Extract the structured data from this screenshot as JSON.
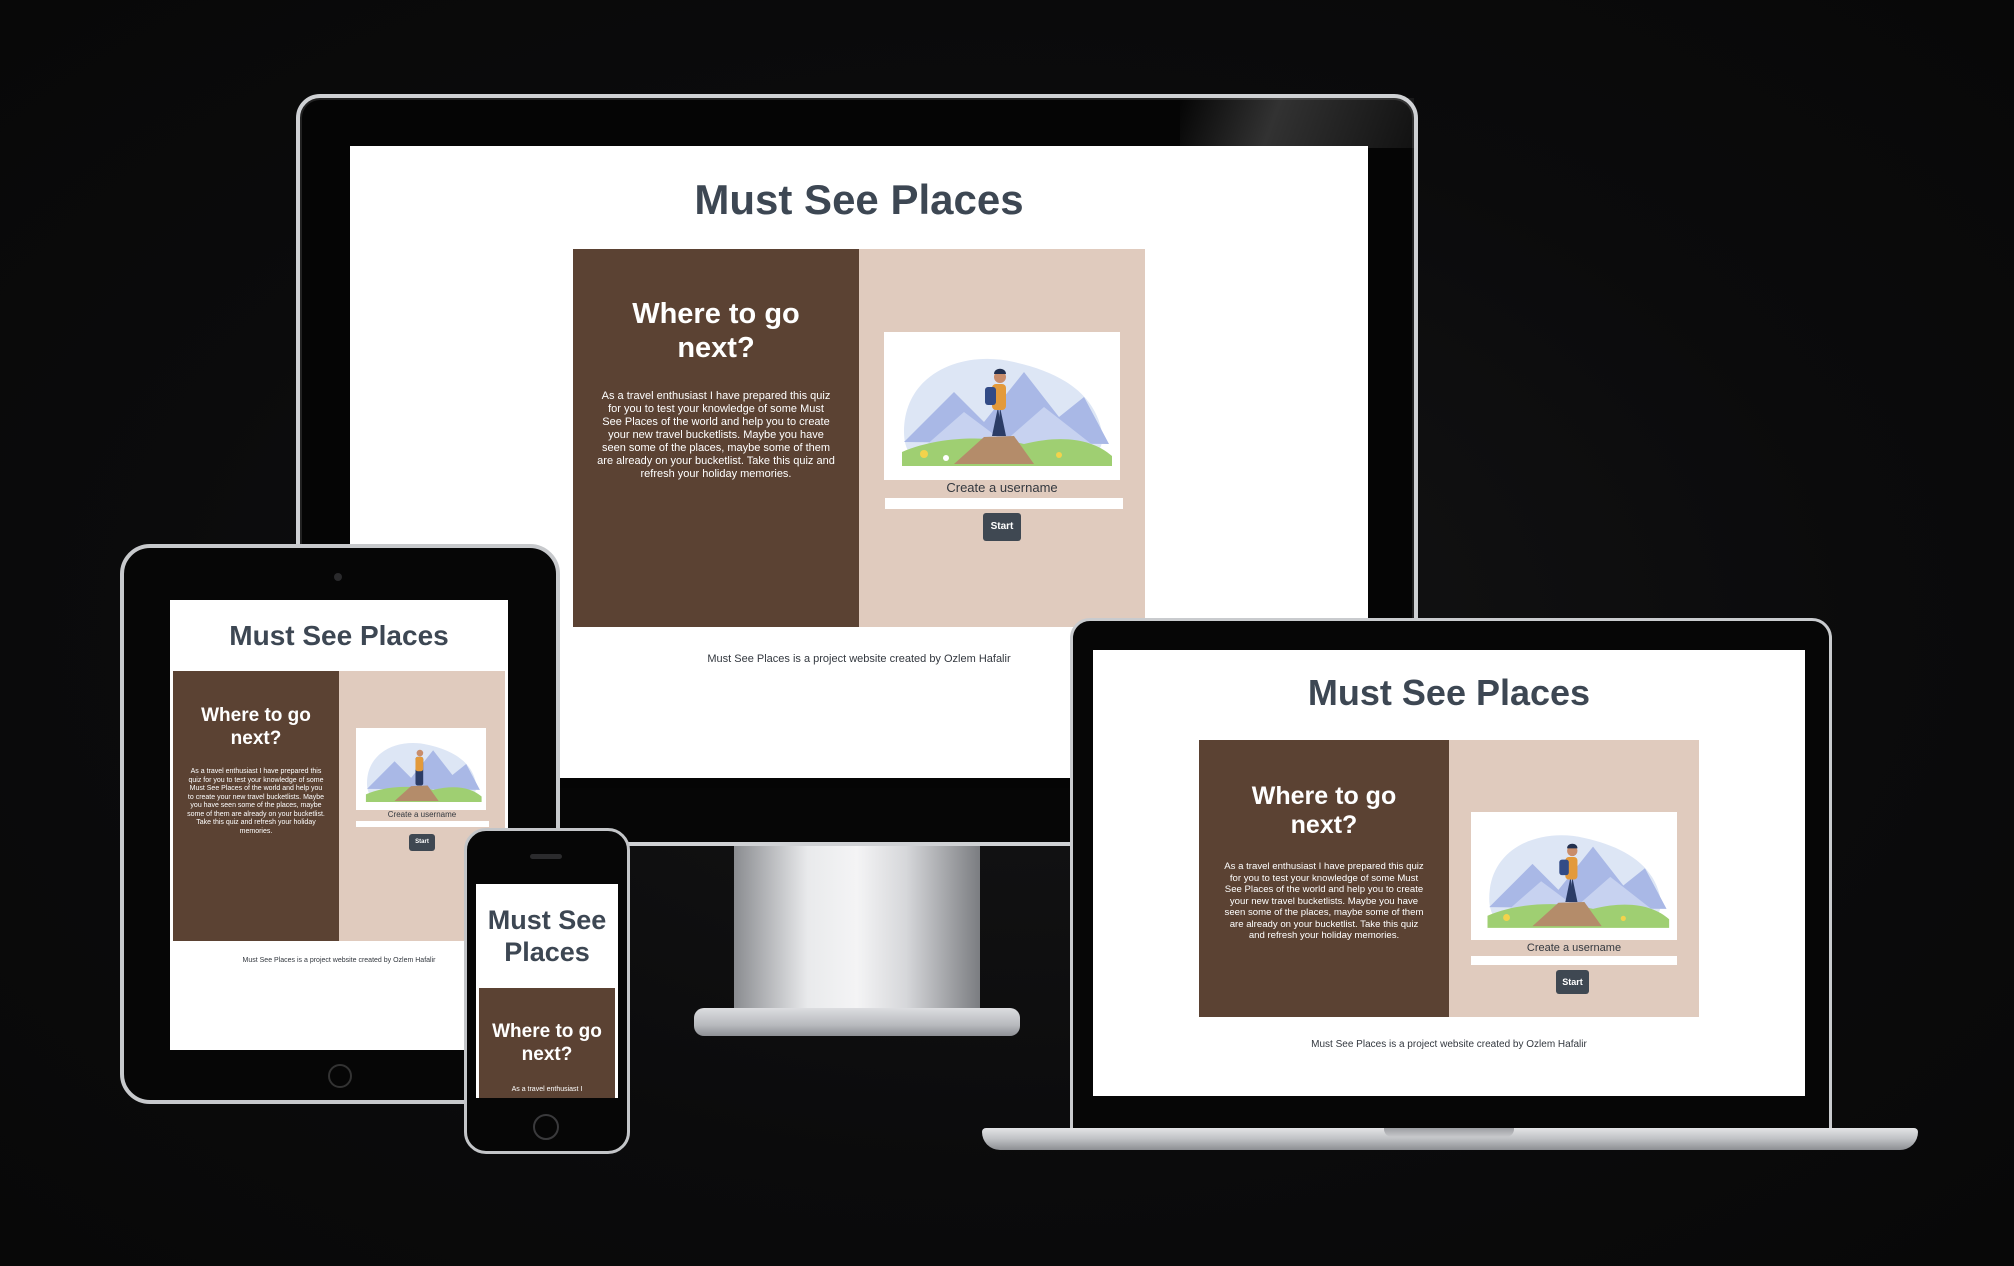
{
  "site": {
    "title": "Must See Places",
    "card_heading": "Where to go next?",
    "card_text": "As a travel enthusiast I have prepared this quiz for you to test your knowledge of some Must See Places of the world and help you to create your new travel bucketlists. Maybe you have seen some of the places, maybe some of them are already on your bucketlist. Take this quiz and refresh your holiday memories.",
    "card_text_phone": "As a travel enthusiast I",
    "username_label": "Create a username",
    "start_label": "Start",
    "footer": "Must See Places is a project website created by Ozlem Hafalir"
  },
  "colors": {
    "title": "#3d4753",
    "card_left": "#5b4233",
    "card_right": "#e0cbbe",
    "button": "#3f4852"
  },
  "icons": [
    "hiker-illustration"
  ]
}
